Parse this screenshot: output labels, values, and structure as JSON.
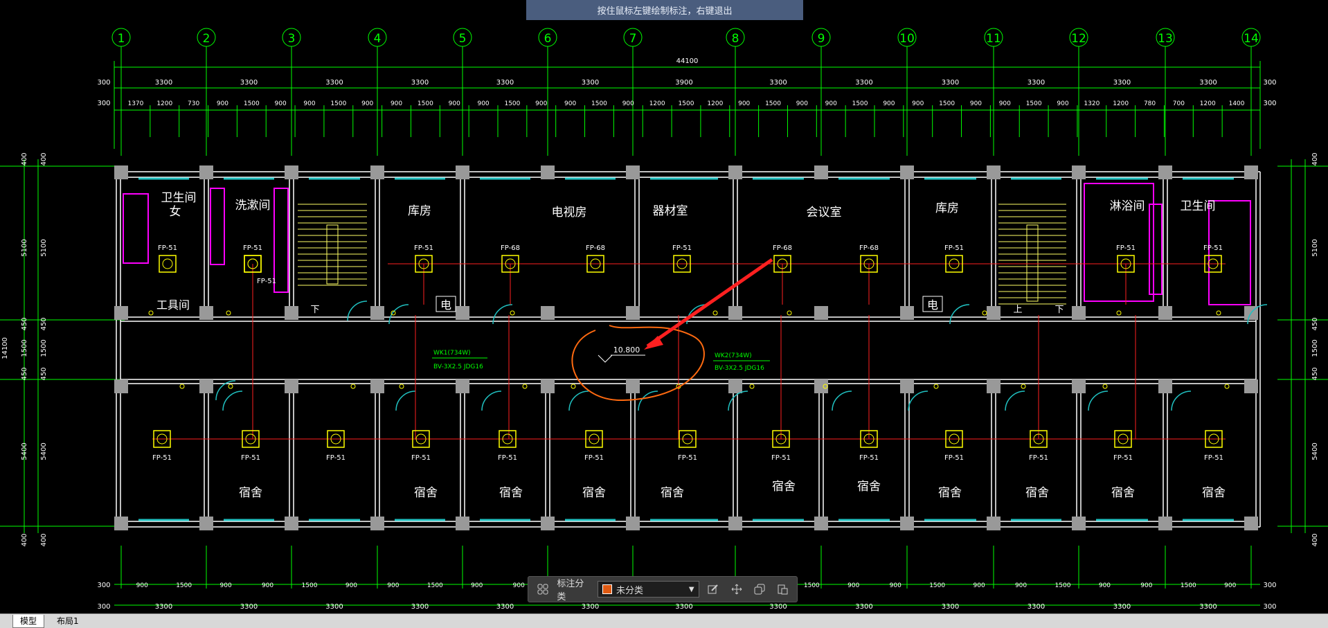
{
  "tooltip": "按住鼠标左键绘制标注，右键退出",
  "axes": [
    "1",
    "2",
    "3",
    "4",
    "5",
    "6",
    "7",
    "8",
    "9",
    "10",
    "11",
    "12",
    "13",
    "14"
  ],
  "dimensions": {
    "total": "44100",
    "top_row1_labels": [
      "300",
      "3300",
      "3300",
      "3300",
      "3300",
      "3300",
      "3300",
      "3900",
      "3300",
      "3300",
      "3300",
      "3300",
      "3300",
      "3300",
      "300"
    ],
    "top_row2_labels": [
      "300",
      "1370",
      "1200",
      "730",
      "900",
      "1500",
      "900",
      "900",
      "1500",
      "900",
      "900",
      "1500",
      "900",
      "900",
      "1500",
      "900",
      "900",
      "1500",
      "900",
      "1200",
      "1500",
      "1200",
      "900",
      "1500",
      "900",
      "900",
      "1500",
      "900",
      "900",
      "1500",
      "900",
      "900",
      "1500",
      "900",
      "1320",
      "1200",
      "780",
      "700",
      "1200",
      "1400",
      "300"
    ],
    "bottom_row1_labels": [
      "300",
      "900",
      "1500",
      "900",
      "900",
      "1500",
      "900",
      "900",
      "1500",
      "900",
      "900",
      "1500",
      "900",
      "900",
      "1500",
      "900",
      "900",
      "1500",
      "900",
      "900",
      "1500",
      "900",
      "900",
      "1500",
      "900",
      "900",
      "1500",
      "900",
      "300"
    ],
    "bottom_row2_labels": [
      "300",
      "3300",
      "3300",
      "3300",
      "3300",
      "3300",
      "3300",
      "3300",
      "3300",
      "3300",
      "3300",
      "3300",
      "3300",
      "3300",
      "300"
    ],
    "left_labels": [
      "400",
      "5100",
      "450",
      "1500",
      "450",
      "5400",
      "400"
    ],
    "left_total": "14100",
    "right_labels": [
      "400",
      "5100",
      "450",
      "1500",
      "450",
      "5400",
      "400"
    ]
  },
  "rooms": {
    "toilet_f": "卫生间",
    "toilet_f_sub": "女",
    "wash": "洗漱间",
    "tool": "工具间",
    "store1": "库房",
    "tv": "电视房",
    "equipment": "器材室",
    "meeting": "会议室",
    "store2": "库房",
    "shower": "淋浴间",
    "toilet2": "卫生间",
    "elec": "电",
    "down": "下",
    "up": "上",
    "dorm": "宿舍"
  },
  "fixture_labels": {
    "fp51": "FP-51",
    "fp68": "FP-68"
  },
  "circuits": {
    "wk1_line1": "WK1(734W)",
    "wk1_line2": "BV-3X2.5 JDG16",
    "wk2_line1": "WK2(734W)",
    "wk2_line2": "BV-3X2.5 JDG16"
  },
  "elevation": "10.800",
  "toolbar": {
    "category_label": "标注分类",
    "category_value": "未分类",
    "category_color": "#e05a12",
    "icons": [
      "layout-icon",
      "edit-icon",
      "move-icon",
      "copy-icon",
      "paste-icon"
    ]
  },
  "tabs": [
    "模型",
    "布局1"
  ],
  "active_tab": 0,
  "colors": {
    "axis": "#00ff00",
    "wall": "#ffffff",
    "fixture": "#ffff00",
    "wire": "#ff2020",
    "sanitary": "#ff00ff",
    "window": "#20c0c0",
    "markup": "#ff6a10",
    "arrow": "#ff2020"
  }
}
